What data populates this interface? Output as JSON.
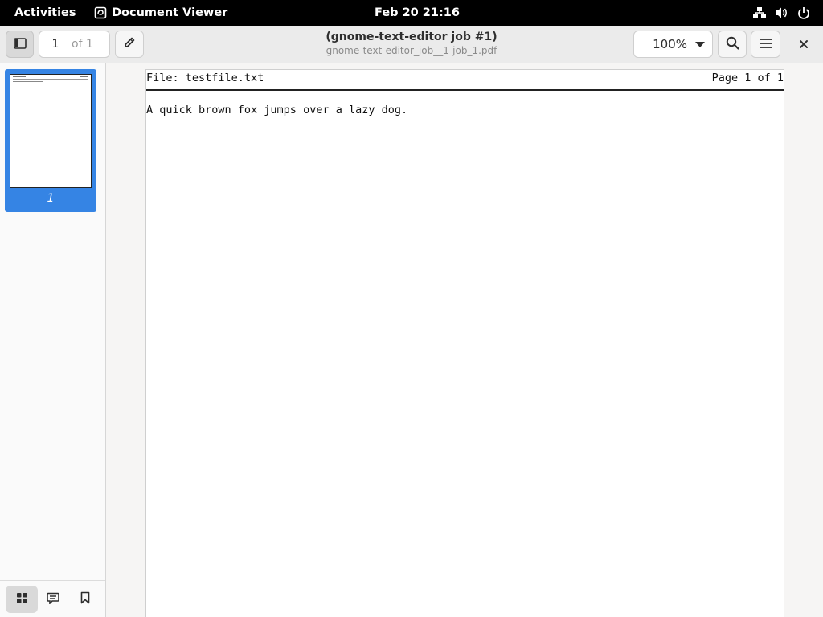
{
  "topbar": {
    "activities": "Activities",
    "app_name": "Document Viewer",
    "clock": "Feb 20  21:16"
  },
  "header": {
    "page_current": "1",
    "page_of": "of 1",
    "title": "(gnome-text-editor job #1)",
    "subtitle": "gnome-text-editor_job__1-job_1.pdf",
    "zoom": "100%"
  },
  "sidebar": {
    "thumbnail_label": "1"
  },
  "document": {
    "header_left": "File: testfile.txt",
    "header_right": "Page 1 of 1",
    "body_text": "A quick brown fox jumps over a lazy dog."
  },
  "colors": {
    "accent": "#3584e4",
    "topbar_bg": "#000000",
    "headerbar_bg": "#ebebeb"
  },
  "icons": [
    "document-viewer-app-icon",
    "network-icon",
    "volume-icon",
    "power-icon",
    "sidebar-toggle-icon",
    "pencil-icon",
    "chevron-down-icon",
    "search-icon",
    "hamburger-menu-icon",
    "close-icon",
    "thumbnails-grid-icon",
    "annotations-icon",
    "bookmark-icon"
  ]
}
